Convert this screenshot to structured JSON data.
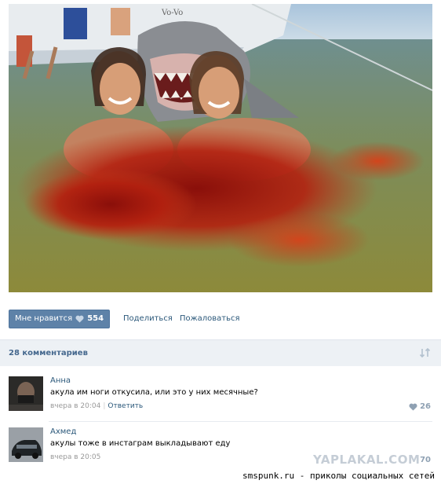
{
  "post": {
    "like_label": "Мне нравится",
    "like_count": "554",
    "share_label": "Поделиться",
    "report_label": "Пожаловаться"
  },
  "comments_header": {
    "title": "28 комментариев"
  },
  "comments": [
    {
      "author": "Анна",
      "text": "акула им ноги откусила, или это у них месячные?",
      "time": "вчера в 20:04",
      "reply_label": "Ответить",
      "likes": "26"
    },
    {
      "author": "Ахмед",
      "text": "акулы тоже в инстаграм выкладывают еду",
      "time": "вчера в 20:05",
      "likes": "70"
    }
  ],
  "watermark": "YAPLAKAL.COM",
  "footer": {
    "source": "smspunk.ru - приколы социальных сетей"
  },
  "colors": {
    "like_button": "#5e82a8",
    "link": "#2b587a",
    "header_bg": "#edf1f5"
  }
}
